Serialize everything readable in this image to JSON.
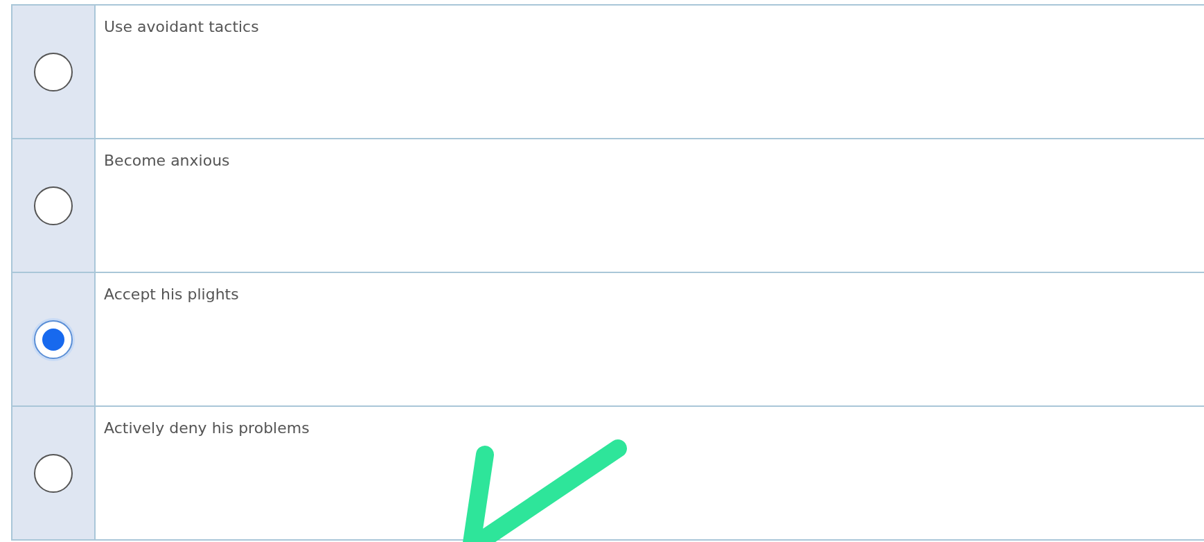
{
  "options": [
    {
      "label": "Use avoidant tactics",
      "selected": false
    },
    {
      "label": "Become anxious",
      "selected": false
    },
    {
      "label": "Accept his plights",
      "selected": true
    },
    {
      "label": "Actively deny his problems",
      "selected": false
    }
  ]
}
